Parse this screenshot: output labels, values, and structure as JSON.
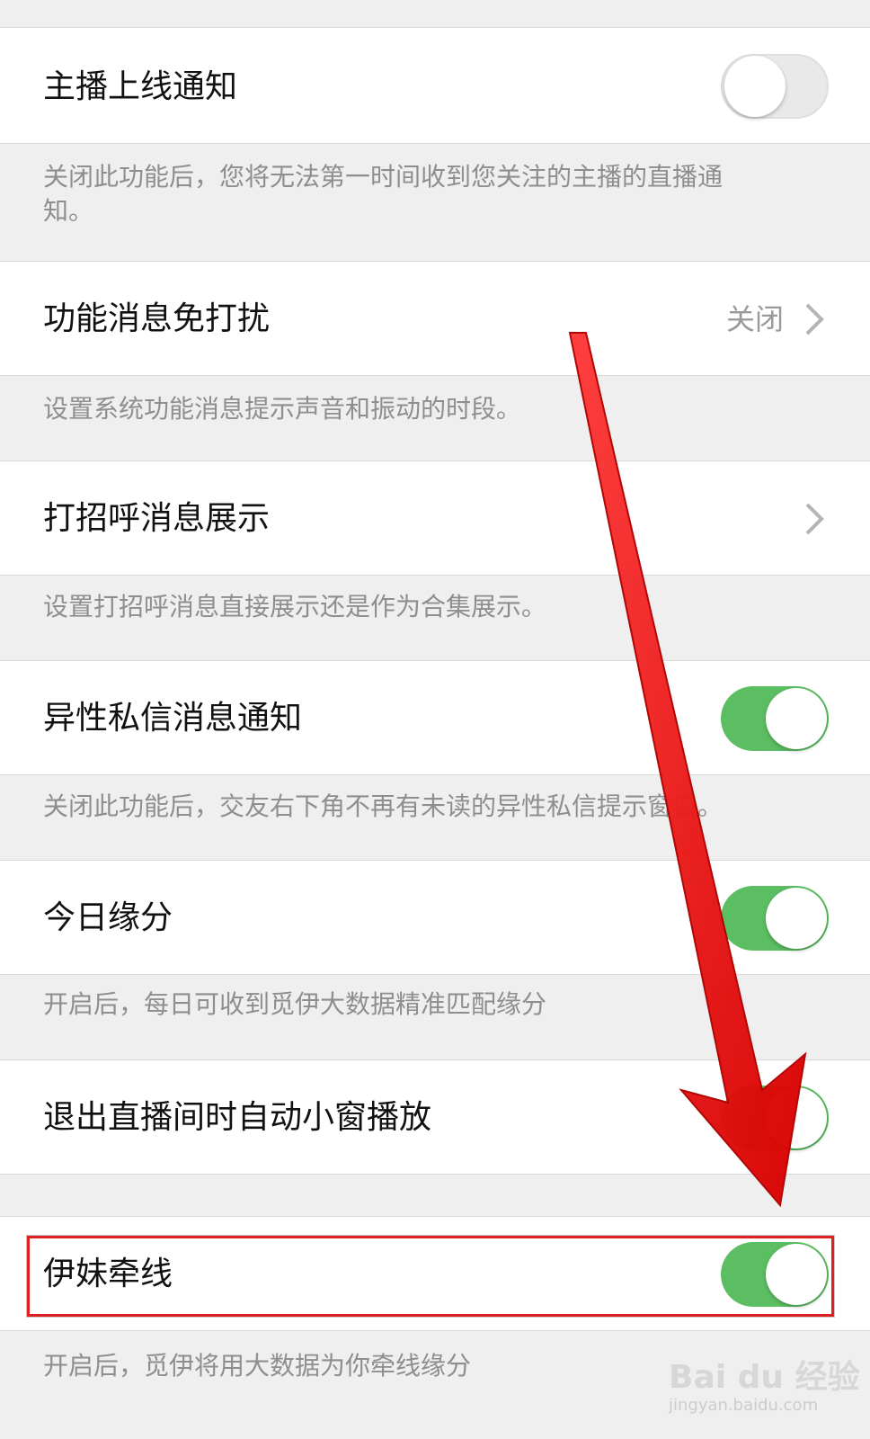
{
  "settings": [
    {
      "label": "主播上线通知",
      "toggle": "off",
      "desc": "关闭此功能后，您将无法第一时间收到您关注的主播的直播通知。"
    },
    {
      "label": "功能消息免打扰",
      "value": "关闭",
      "desc": "设置系统功能消息提示声音和振动的时段。"
    },
    {
      "label": "打招呼消息展示",
      "desc": "设置打招呼消息直接展示还是作为合集展示。"
    },
    {
      "label": "异性私信消息通知",
      "toggle": "on",
      "desc": "关闭此功能后，交友右下角不再有未读的异性私信提示窗口。"
    },
    {
      "label": "今日缘分",
      "toggle": "on",
      "desc": "开启后，每日可收到觅伊大数据精准匹配缘分"
    },
    {
      "label": "退出直播间时自动小窗播放",
      "toggle": "on"
    },
    {
      "label": "伊妹牵线",
      "toggle": "on",
      "highlighted": true,
      "desc": "开启后，觅伊将用大数据为你牵线缘分"
    }
  ],
  "annotation": {
    "arrow_color": "#e8141a",
    "highlight_color": "#e02020"
  },
  "colors": {
    "toggle_on": "#5cbe62",
    "background": "#efefef"
  },
  "watermark": {
    "brand": "Bai du 经验",
    "url": "jingyan.baidu.com"
  }
}
